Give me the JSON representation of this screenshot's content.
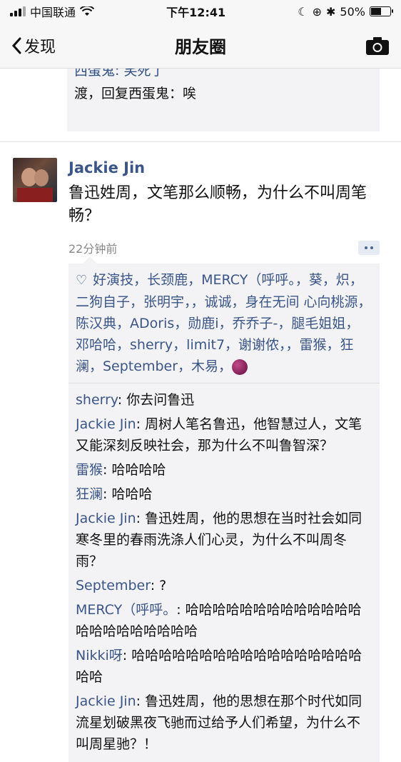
{
  "status": {
    "carrier": "中国联通",
    "time": "下午12:41",
    "battery": "50%"
  },
  "nav": {
    "back_label": "发现",
    "title": "朋友圈"
  },
  "prev_comments": {
    "cut_line": "西蛋鬼: 笑死了",
    "line": "渡，回复西蛋鬼：唉"
  },
  "post": {
    "author": "Jackie Jin",
    "text": "鲁迅姓周，文笔那么顺畅，为什么不叫周笔畅？",
    "time": "22分钟前",
    "likes": "好演技，长颈鹿，MERCY（呼呼。，葵，炽，二狗自子，张明宇，，诚诚，身在无间 心向桃源，陈汉典，ADoris，勋鹿i，乔乔子-，腿毛姐姐，邓哈哈，sherry，limit7，谢谢侬，，雷猴，狂澜，September，木易，",
    "comments": [
      {
        "who": "sherry",
        "sep": ": ",
        "text": "你去问鲁迅"
      },
      {
        "who": "Jackie Jin",
        "sep": ": ",
        "text": "周树人笔名鲁迅，他智慧过人，文笔又能深刻反映社会，那为什么不叫鲁智深？"
      },
      {
        "who": "雷猴",
        "sep": ": ",
        "text": "哈哈哈哈"
      },
      {
        "who": "狂澜",
        "sep": ": ",
        "text": "哈哈哈"
      },
      {
        "who": "Jackie Jin",
        "sep": ": ",
        "text": "鲁迅姓周，他的思想在当时社会如同寒冬里的春雨洗涤人们心灵，为什么不叫周冬雨？"
      },
      {
        "who": "September",
        "sep": ": ",
        "text": "?"
      },
      {
        "who": "MERCY（呼呼。",
        "sep": ": ",
        "text": "哈哈哈哈哈哈哈哈哈哈哈哈哈哈哈哈哈哈哈哈哈哈"
      },
      {
        "who": "Nikki呀",
        "sep": ": ",
        "text": "哈哈哈哈哈哈哈哈哈哈哈哈哈哈哈哈哈哈哈"
      },
      {
        "who": "Jackie Jin",
        "sep": ": ",
        "text": "鲁迅姓周，他的思想在那个时代如同流星划破黑夜飞驰而过给予人们希望，为什么不叫周星驰？！"
      }
    ]
  }
}
